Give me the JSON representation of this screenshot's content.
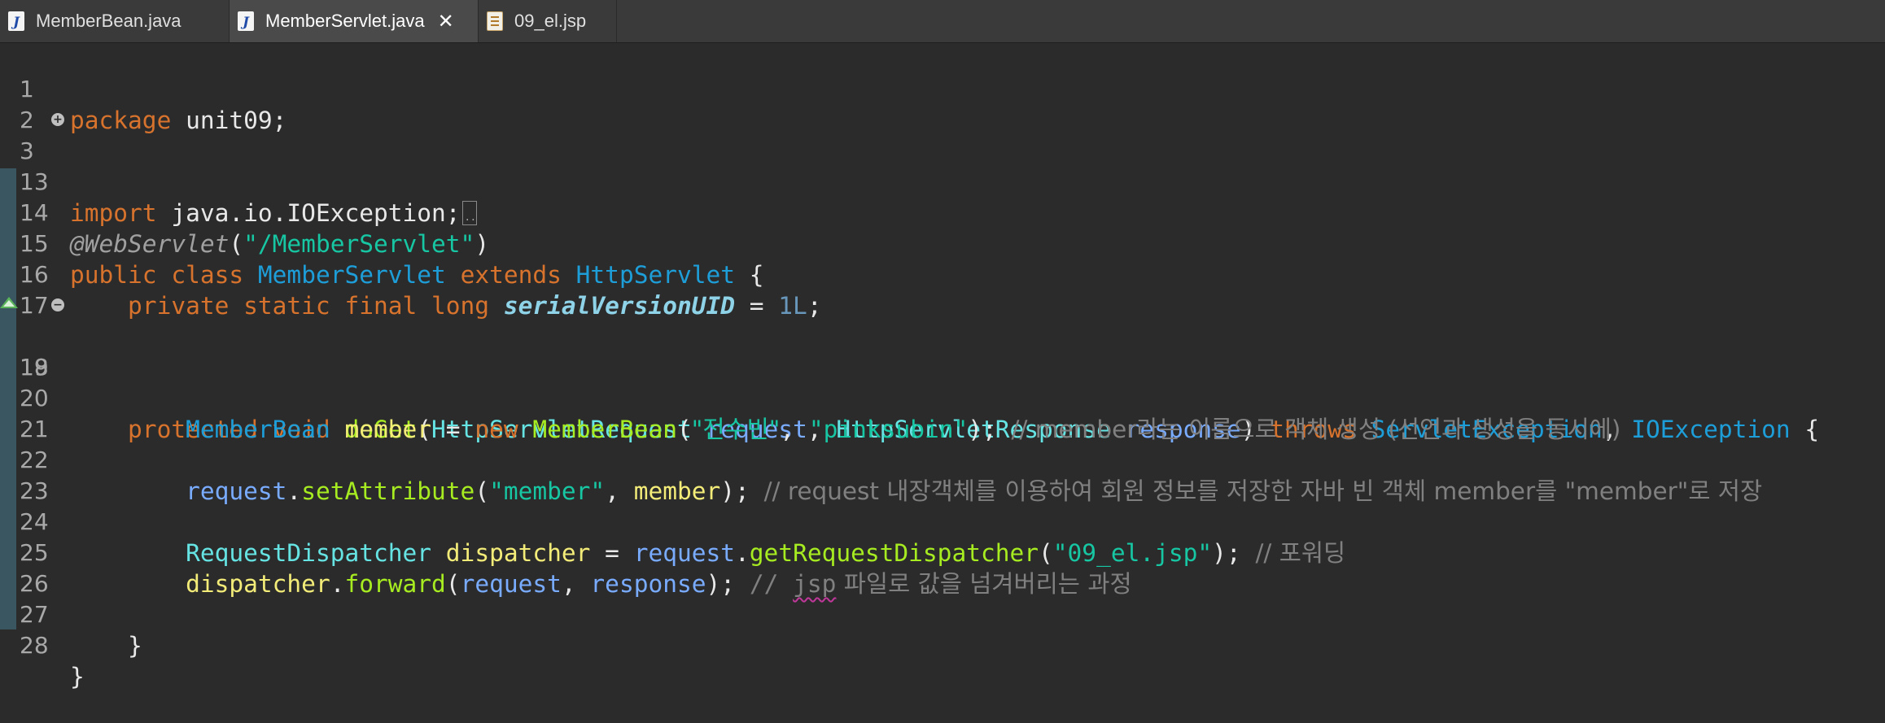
{
  "tabs": [
    {
      "label": "MemberBean.java",
      "icon": "java-file-icon",
      "active": false
    },
    {
      "label": "MemberServlet.java",
      "icon": "java-file-icon",
      "active": true
    },
    {
      "label": "09_el.jsp",
      "icon": "jsp-file-icon",
      "active": false
    }
  ],
  "code": {
    "l1": {
      "num": "1",
      "kw": "package",
      "rest": " unit09;"
    },
    "l2": {
      "num": "2"
    },
    "l3": {
      "num": "3",
      "kw": "import",
      "rest": " java.io.IOException;"
    },
    "l13": {
      "num": "13"
    },
    "l14": {
      "num": "14",
      "ann": "@WebServlet",
      "p1": "(",
      "str": "\"/MemberServlet\"",
      "p2": ")"
    },
    "l15": {
      "num": "15",
      "kw1": "public class",
      "cls": "MemberServlet",
      "kw2": "extends",
      "sup": "HttpServlet",
      "brace": " {"
    },
    "l16": {
      "num": "16",
      "kw": "private static final long",
      "field": "serialVersionUID",
      "eq": " = ",
      "val": "1L",
      "semi": ";"
    },
    "l17": {
      "num": "17"
    },
    "l18": {
      "num": "18",
      "kw1": "protected void",
      "name": "doGet",
      "t1": "HttpServletRequest",
      "p1": "request",
      "t2": "HttpServletResponse",
      "p2": "response",
      "kw2": "throws",
      "e1": "ServletException",
      "e2": "IOException"
    },
    "l19": {
      "num": "19"
    },
    "l20": {
      "num": "20",
      "type": "MemberBean",
      "var": "member",
      "kw": "new",
      "ctor": "MemberBean",
      "s1": "\"전수빈\"",
      "s2": "\"pinksubin\"",
      "cmt": "// member라는 이름으로 객체 생성 (선언과 생성을 동시에)"
    },
    "l21": {
      "num": "21"
    },
    "l22": {
      "num": "22",
      "obj": "request",
      "m": "setAttribute",
      "s": "\"member\"",
      "arg": "member",
      "cmt": "// request 내장객체를 이용하여 회원 정보를 저장한 자바 빈 객체 member를 \"member\"로 저장"
    },
    "l23": {
      "num": "23"
    },
    "l24": {
      "num": "24",
      "type": "RequestDispatcher",
      "var": "dispatcher",
      "obj": "request",
      "m": "getRequestDispatcher",
      "s": "\"09_el.jsp\"",
      "cmt": "// 포워딩"
    },
    "l25": {
      "num": "25",
      "var": "dispatcher",
      "m": "forward",
      "a1": "request",
      "a2": "response",
      "cmt1": "// ",
      "cmt2": "jsp",
      "cmt3": " 파일로 값을 넘겨버리는 과정"
    },
    "l26": {
      "num": "26"
    },
    "l27": {
      "num": "27",
      "brace": "}"
    },
    "l28": {
      "num": "28",
      "brace": "}"
    }
  },
  "colors": {
    "keyword": "#d7732d",
    "type": "#1e9ed8",
    "string": "#17c6a3",
    "comment": "#808080",
    "method": "#a7ec21",
    "local_var": "#f3ec79",
    "parameter": "#79abff",
    "background": "#2b2b2b"
  }
}
